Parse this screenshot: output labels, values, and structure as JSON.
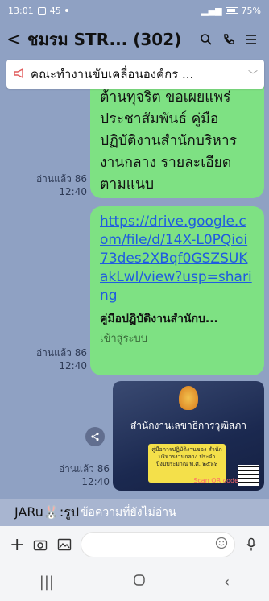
{
  "status_bar": {
    "time": "13:01",
    "notif_count": "45",
    "battery": "75%"
  },
  "header": {
    "back_label": "<",
    "title": "ชมรม STR... (302)"
  },
  "announcement": {
    "text": "คณะทำงานขับเคลื่อนองค์กร ..."
  },
  "messages": [
    {
      "type": "text",
      "text": "ต้านทุจริต ขอเผยแพร่ ประชาสัมพันธ์ คู่มือ ปฏิบัติงานสำนักบริหาร งานกลาง รายละเอียด ตามแนบ",
      "read_status": "อ่านแล้ว 86",
      "time": "12:40"
    },
    {
      "type": "link",
      "url": "https://drive.google.com/file/d/14X-L0PQioi73des2XBqf0GSZSUKakLwl/view?usp=sharing",
      "preview_title": "คู่มือปฏิบัติงานสำนักบ...",
      "preview_subtitle": "เข้าสู่ระบบ",
      "read_status": "อ่านแล้ว 86",
      "time": "12:40"
    },
    {
      "type": "image",
      "image_banner": "สำนักงานเลขาธิการวุฒิสภา",
      "image_card_text": "คู่มือการปฏิบัติงานของ สำนักบริหารงานกลาง ประจำปีงบประมาณ พ.ศ. ๒๕๖๖",
      "qr_label": "Scan QR code",
      "read_status": "อ่านแล้ว 86",
      "time": "12:40"
    }
  ],
  "unread_banner": {
    "sender": "JARu🐰:รูป",
    "text": "ข้อความที่ยังไม่อ่าน"
  },
  "input_bar": {
    "placeholder": ""
  },
  "colors": {
    "chat_bg": "#8fa1c3",
    "bubble": "#7ee183",
    "link": "#1f5be0"
  }
}
